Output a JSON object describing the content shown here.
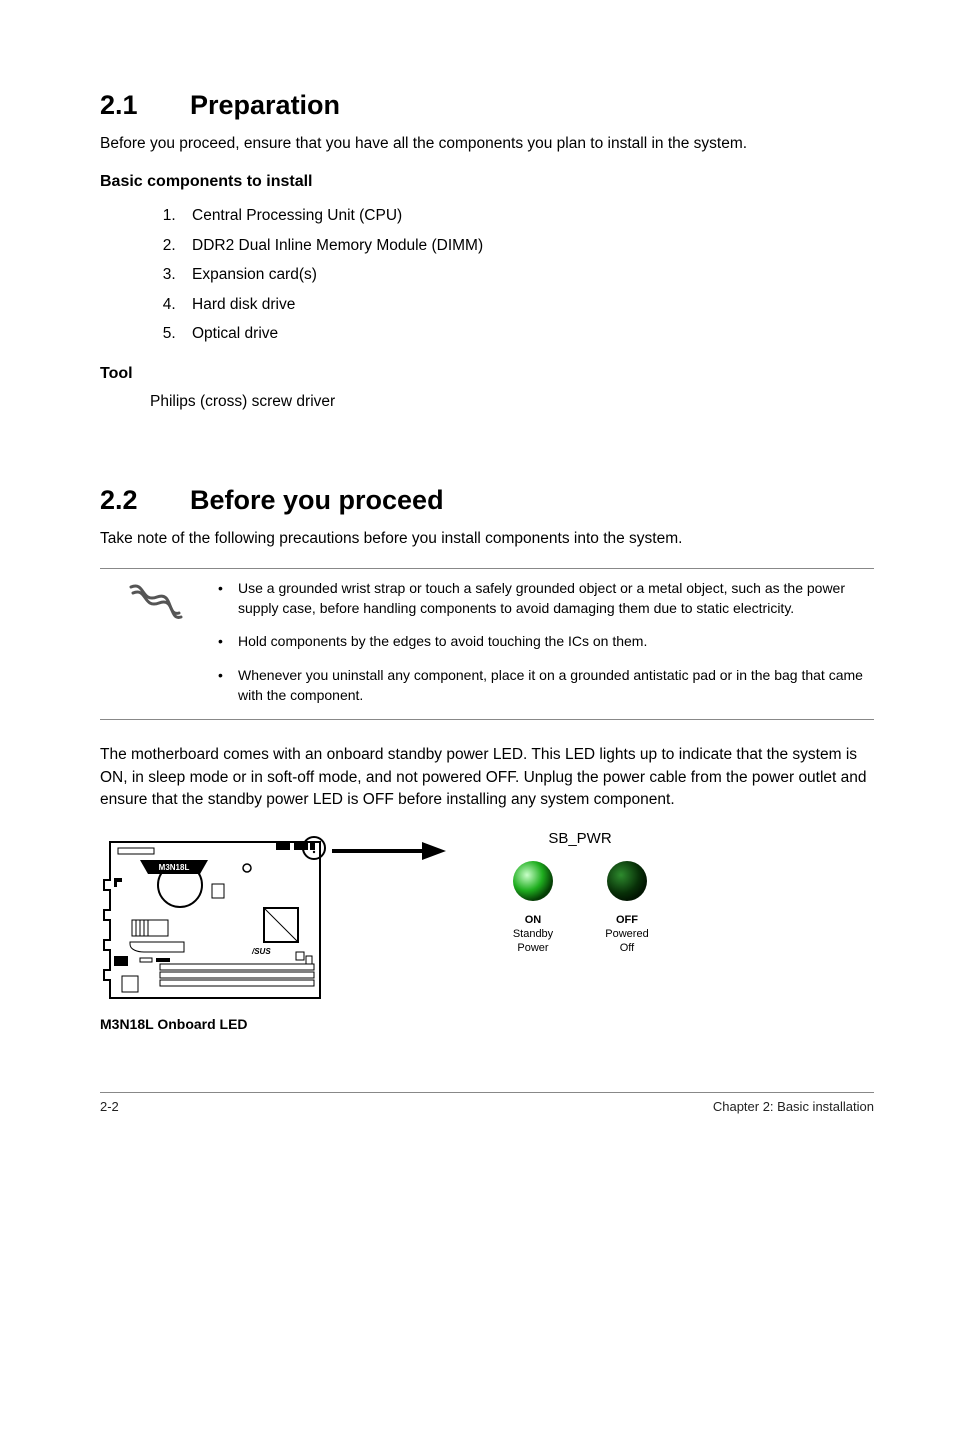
{
  "section1": {
    "num": "2.1",
    "title": "Preparation",
    "intro": "Before you proceed, ensure that you have all the components you plan to install in the system.",
    "components_head": "Basic components to install",
    "components": [
      "Central Processing Unit (CPU)",
      "DDR2 Dual Inline Memory Module (DIMM)",
      "Expansion card(s)",
      "Hard disk drive",
      "Optical drive"
    ],
    "tool_head": "Tool",
    "tool_text": "Philips (cross) screw driver"
  },
  "section2": {
    "num": "2.2",
    "title": "Before you proceed",
    "intro": "Take note of the following precautions before you install components into the system.",
    "notes": [
      "Use a grounded wrist strap or touch a safely grounded object or a metal object, such as the power supply case, before handling components to avoid damaging them due to static electricity.",
      "Hold components by the edges to avoid touching the ICs on them.",
      "Whenever you uninstall any component, place it on a grounded antistatic pad or in the bag that came with the component."
    ],
    "body2": "The motherboard comes with an onboard standby power LED. This LED lights up to indicate that the system is ON, in sleep mode or in soft-off mode, and not powered OFF. Unplug the power cable from the power outlet and ensure that the standby power LED is OFF before installing any system component."
  },
  "figure": {
    "board_label": "M3N18L",
    "caption": "M3N18L Onboard LED",
    "led_title": "SB_PWR",
    "on": {
      "state": "ON",
      "line1": "Standby",
      "line2": "Power"
    },
    "off": {
      "state": "OFF",
      "line1": "Powered",
      "line2": "Off"
    }
  },
  "footer": {
    "left": "2-2",
    "right": "Chapter 2: Basic installation"
  }
}
